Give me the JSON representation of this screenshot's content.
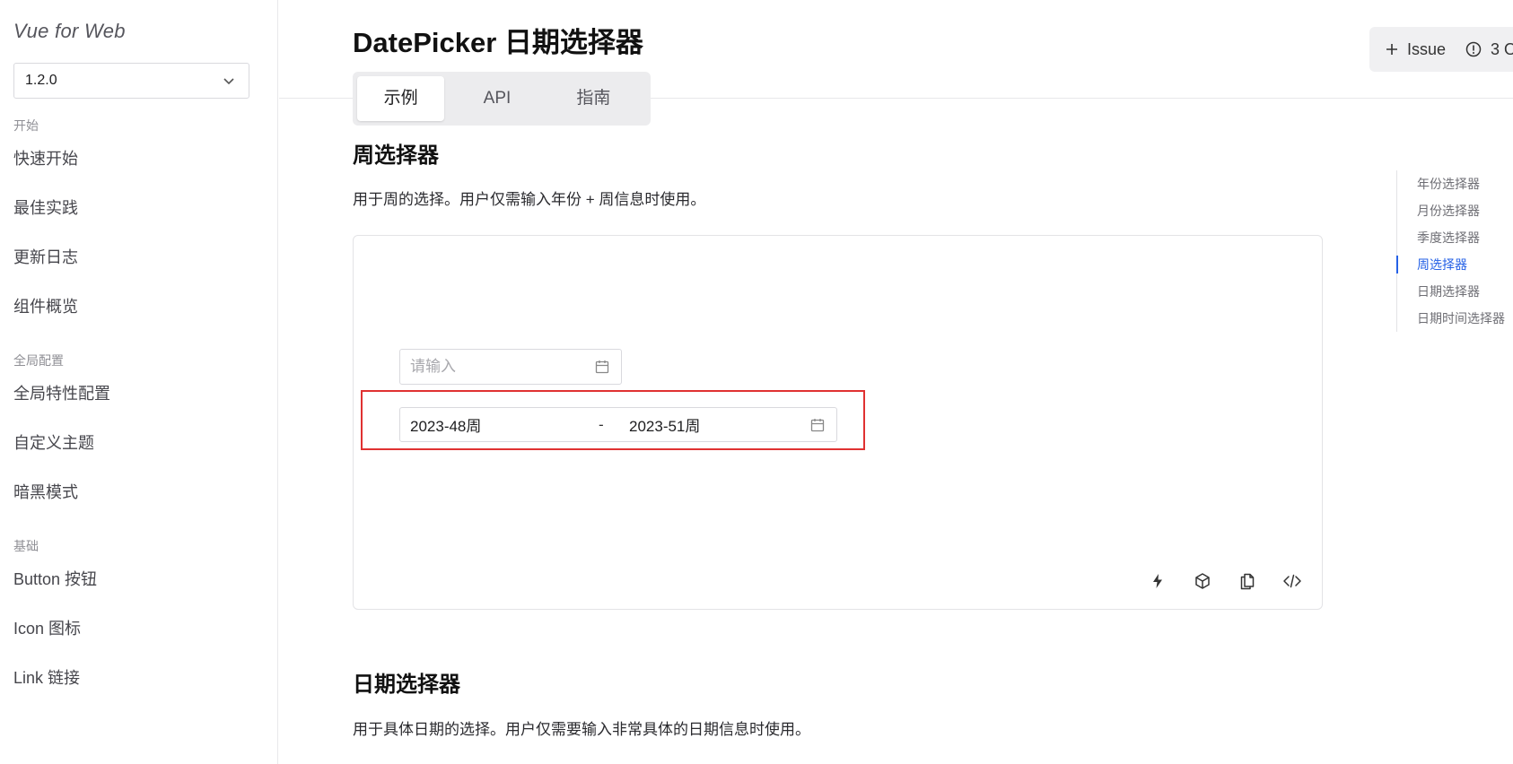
{
  "sidebar": {
    "brand": "Vue for Web",
    "version": "1.2.0",
    "groups": [
      {
        "title": "开始",
        "items": [
          "快速开始",
          "最佳实践",
          "更新日志",
          "组件概览"
        ]
      },
      {
        "title": "全局配置",
        "items": [
          "全局特性配置",
          "自定义主题",
          "暗黑模式"
        ]
      },
      {
        "title": "基础",
        "items": [
          "Button 按钮",
          "Icon 图标",
          "Link 链接"
        ]
      }
    ]
  },
  "header": {
    "title": "DatePicker 日期选择器",
    "tabs": [
      "示例",
      "API",
      "指南"
    ],
    "active_tab": 0,
    "issue_label": "Issue",
    "open_count": "3 O"
  },
  "week_section": {
    "title": "周选择器",
    "description": "用于周的选择。用户仅需输入年份 + 周信息时使用。",
    "input_placeholder": "请输入",
    "range_start": "2023-48周",
    "range_separator": "-",
    "range_end": "2023-51周"
  },
  "date_section": {
    "title": "日期选择器",
    "description": "用于具体日期的选择。用户仅需要输入非常具体的日期信息时使用。"
  },
  "toc": {
    "items": [
      "年份选择器",
      "月份选择器",
      "季度选择器",
      "周选择器",
      "日期选择器",
      "日期时间选择器"
    ],
    "active": 3
  },
  "colors": {
    "accent": "#2561e6",
    "highlight": "#e03131"
  }
}
